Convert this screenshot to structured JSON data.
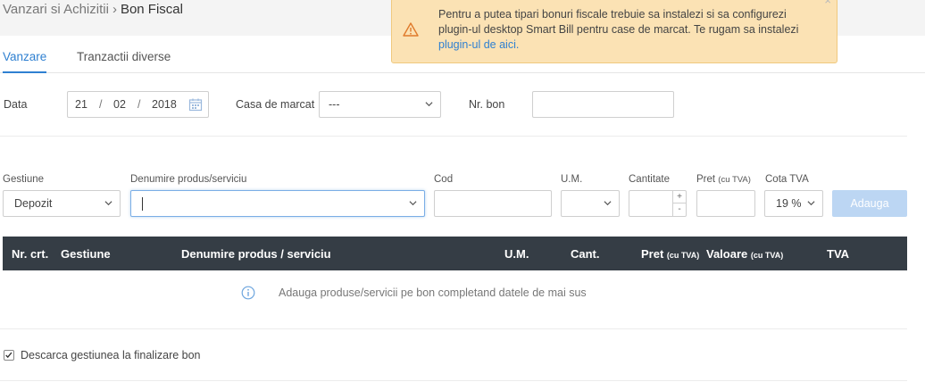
{
  "breadcrumb": {
    "parent": "Vanzari si Achizitii",
    "separator": "›",
    "current": "Bon Fiscal"
  },
  "alert": {
    "text": "Pentru a putea tipari bonuri fiscale trebuie sa instalezi si sa configurezi plugin-ul desktop Smart Bill pentru case de marcat. Te rugam sa instalezi ",
    "link_text": "plugin-ul de aici.",
    "close_label": "×",
    "color": "#fbe2b4"
  },
  "tabs": [
    {
      "label": "Vanzare",
      "active": true
    },
    {
      "label": "Tranzactii diverse",
      "active": false
    }
  ],
  "header_form": {
    "date_label": "Data",
    "date": {
      "day": "21",
      "month": "02",
      "year": "2018",
      "separator": "/"
    },
    "cash_register_label": "Casa de marcat",
    "cash_register_value": "---",
    "receipt_no_label": "Nr. bon",
    "receipt_no_value": ""
  },
  "product_form": {
    "gestiune_label": "Gestiune",
    "gestiune_value": "Depozit",
    "product_label": "Denumire produs/serviciu",
    "product_value": "",
    "code_label": "Cod",
    "um_label": "U.M.",
    "quantity_label": "Cantitate",
    "price_label": "Pret",
    "price_suffix": "(cu TVA)",
    "vat_label": "Cota TVA",
    "vat_value": "19 %",
    "stepper_up": "+",
    "stepper_down": "-",
    "add_button": "Adauga"
  },
  "table": {
    "columns": {
      "nr": "Nr. crt.",
      "gestiune": "Gestiune",
      "product": "Denumire produs / serviciu",
      "um": "U.M.",
      "qty": "Cant.",
      "price": "Pret",
      "price_suffix": "(cu TVA)",
      "value": "Valoare",
      "value_suffix": "(cu TVA)",
      "vat": "TVA"
    },
    "header_color": "#353d45",
    "empty_message": "Adauga produse/servicii pe bon completand datele de mai sus"
  },
  "options": {
    "discharge_label": "Descarca gestiunea la finalizare bon",
    "discharge_checked": true
  },
  "colors": {
    "accent": "#2f80d1",
    "button_disabled": "#bcd6f3"
  },
  "icons": {
    "warning": "warning-icon",
    "calendar": "calendar-icon",
    "info": "info-icon",
    "chevron": "chevron-down-icon"
  }
}
